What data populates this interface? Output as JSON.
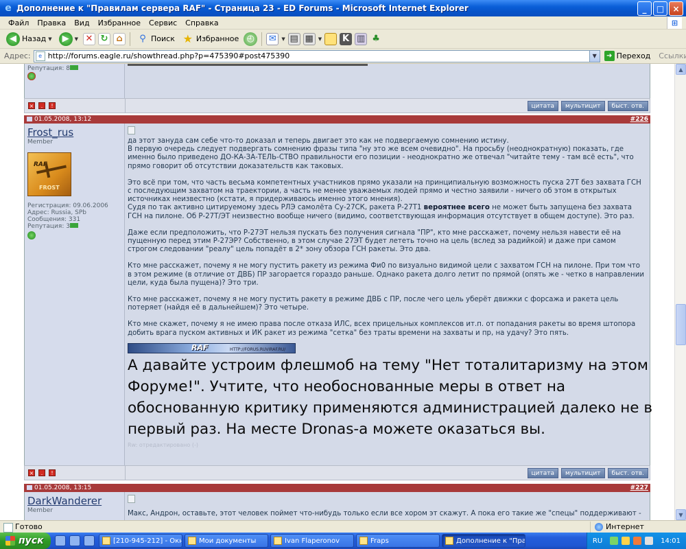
{
  "window": {
    "title": "Дополнение к \"Правилам сервера RAF\" - Страница 23 - ED Forums - Microsoft Internet Explorer"
  },
  "menu": [
    "Файл",
    "Правка",
    "Вид",
    "Избранное",
    "Сервис",
    "Справка"
  ],
  "toolbar": {
    "back": "Назад",
    "search": "Поиск",
    "favorites": "Избранное"
  },
  "address": {
    "label": "Адрес:",
    "url": "http://forums.eagle.ru/showthread.php?p=475390#post475390",
    "go": "Переход",
    "links": "Ссылки"
  },
  "prev_post": {
    "reputation": "Репутация: 8"
  },
  "buttons": {
    "quote": "цитата",
    "multiquote": "мультицит",
    "quick_reply": "быст. отв."
  },
  "post1": {
    "date": "01.05.2008, 13:12",
    "number": "#226",
    "username": "Frost_rus",
    "role": "Member",
    "avatar_text": "RAF",
    "avatar_caption": "FROST",
    "registered": "Регистрация: 09.06.2006",
    "location": "Адрес: Russia, SPb",
    "messages": "Сообщения: 331",
    "reputation": "Репутация: 3",
    "p1": "да этот зануда сам себе что-то доказал и теперь двигает это как не подвергаемую сомнению истину.\nВ первую очередь следует подвергать сомнению фразы типа \"ну это же всем очевидно\". На просьбу (неоднократную) показать, где именно было приведено ДО-КА-ЗА-ТЕЛЬ-СТВО правильности его позиции - неоднократно же отвечал \"читайте тему - там всё есть\", что прямо говорит об отсутствии доказательств как таковых.",
    "p2a": "Это всё при том, что часть весьма компетентных участников прямо указали на принципиальную возможность пуска 27Т без захвата ГСН с последующим захватом на траектории, а часть не менее уважаемых людей прямо и честно заявили - ничего об этом в открытых источниках неизвестно (кстати, я придерживаюсь именно этого мнения).\nСудя по так активно цитируемому здесь РЛЭ самолёта Су-27СК, ракета Р-27Т1 ",
    "p2b": "вероятнее всего",
    "p2c": " не может быть запущена без захвата ГСН на пилоне. Об Р-27Т/ЭТ неизвестно вообще ничего (видимо, соответствующая информация отсутствует в общем доступе). Это раз.",
    "p3": "Даже если предположить, что Р-27ЭТ нельзя пускать без получения сигнала \"ПР\", кто мне расскажет, почему нельзя навести её на пущенную перед этим Р-27ЭР? Собственно, в этом случае 27ЭТ будет лететь точно на цель (вслед за радийкой) и даже при самом строгом следовании \"реалу\" цель попадёт в 2* зону обзора ГСН ракеты. Это два.",
    "p4": "Кто мне расскажет, почему я не могу пустить ракету из режима Фи0 по визуально видимой цели с захватом ГСН на пилоне. При том что в этом режиме (в отличие от ДВБ) ПР загорается гораздо раньше. Однако ракета долго летит по прямой (опять же - четко в направлении цели, куда была пущена)? Это три.",
    "p5": "Кто мне расскажет, почему я не могу пустить ракету в режиме ДВБ с ПР, после чего цель уберёт движки с форсажа и ракета цель потеряет (найдя её в дальнейшем)? Это четыре.",
    "p6": "Кто мне скажет, почему я не имею права после отказа ИЛС, всех прицельных комплексов ит.п. от попадания ракеты во время штопора добить врага пуском активных и ИК ракет из режима \"сетка\" без траты времени на захваты и пр, на удачу? Это пять.",
    "banner_text": "RAF",
    "banner_url": "HTTP://FORUS.RUVIRAF.RU/",
    "signature": "А давайте устроим флешмоб на тему \"Нет тоталитаризму на этом Форуме!\". Учтите, что необоснованные меры в ответ на обоснованную критику применяются администрацией далеко не в первый раз. На месте Dronas-а можете оказаться вы.",
    "edited": "Rw: отредактировано (-)"
  },
  "post2": {
    "date": "01.05.2008, 13:15",
    "number": "#227",
    "username": "DarkWanderer",
    "role": "Member",
    "text": "Макс, Андрон, оставьте, этот человек поймет что-нибудь только если все хором эт скажут. А пока его такие же \"спецы\" поддерживают -"
  },
  "status": {
    "text": "Готово",
    "zone": "Интернет"
  },
  "taskbar": {
    "start": "пуск",
    "tasks": [
      "[210-945-212] - Окн...",
      "Мои документы",
      "Ivan Flaperonov",
      "Fraps",
      "Дополнение к \"Прав..."
    ],
    "lang": "RU",
    "clock": "14:01"
  }
}
